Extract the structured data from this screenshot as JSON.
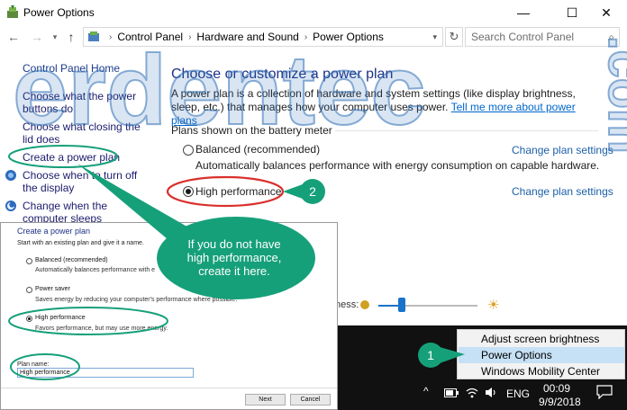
{
  "window": {
    "title": "Power Options",
    "controls": {
      "minimize": "—",
      "maximize": "☐",
      "close": "✕"
    }
  },
  "nav": {
    "back_icon": "back-arrow-icon",
    "forward_icon": "forward-arrow-icon",
    "up_icon": "up-arrow-icon",
    "breadcrumb": [
      "Control Panel",
      "Hardware and Sound",
      "Power Options"
    ],
    "search_placeholder": "Search Control Panel"
  },
  "sidebar": {
    "home": "Control Panel Home",
    "items": [
      {
        "label": "Choose what the power buttons do"
      },
      {
        "label": "Choose what closing the lid does"
      },
      {
        "label": "Create a power plan"
      },
      {
        "label": "Choose when to turn off the display"
      },
      {
        "label": "Change when the computer sleeps"
      }
    ]
  },
  "main": {
    "heading": "Choose or customize a power plan",
    "description": "A power plan is a collection of hardware and system settings (like display brightness, sleep, etc.) that manages how your computer uses power.",
    "link": "Tell me more about power plans",
    "section": "Plans shown on the battery meter",
    "plans": [
      {
        "name": "Balanced (recommended)",
        "description": "Automatically balances performance with energy consumption on capable hardware.",
        "link": "Change plan settings",
        "selected": false
      },
      {
        "name": "High performance",
        "description": "",
        "link": "Change plan settings",
        "selected": true
      }
    ],
    "brightness_label": "ness:",
    "brightness_level": 0.24
  },
  "inset": {
    "title": "Create a power plan",
    "subtitle": "Start with an existing plan and give it a name.",
    "plans": [
      {
        "name": "Balanced (recommended)",
        "description": "Automatically balances performance with e",
        "selected": false
      },
      {
        "name": "Power saver",
        "description": "Saves energy by reducing your computer's performance where possible.",
        "selected": false
      },
      {
        "name": "High performance",
        "description": "Favors performance, but may use more energy.",
        "selected": true
      }
    ],
    "plan_name_label": "Plan name:",
    "plan_name_value": "High performance",
    "next": "Next",
    "cancel": "Cancel"
  },
  "context_menu": {
    "items": [
      {
        "label": "Adjust screen brightness",
        "highlighted": false
      },
      {
        "label": "Power Options",
        "highlighted": true
      },
      {
        "label": "Windows Mobility Center",
        "highlighted": false
      }
    ]
  },
  "taskbar": {
    "language": "ENG",
    "time": "00:09",
    "date": "9/9/2018"
  },
  "annotations": {
    "callout": "If you do not have high performance, create it here.",
    "badge_1": "1",
    "badge_2": "2",
    "accent": "#16a07a",
    "highlight_red": "#d9302c"
  },
  "watermark": "erdentec.com"
}
